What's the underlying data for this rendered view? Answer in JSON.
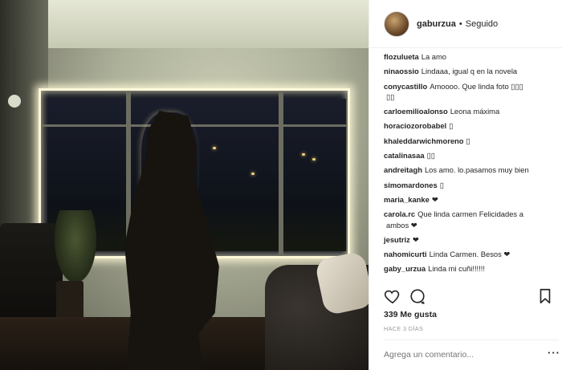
{
  "post": {
    "username": "gaburzua",
    "separator": "•",
    "follow_status": "Seguido",
    "likes": "339 Me gusta",
    "time_ago": "HACE 3 DÍAS",
    "comment_placeholder": "Agrega un comentario...",
    "more_label": "···"
  },
  "comments": [
    {
      "author": "flozulueta",
      "text": "La amo"
    },
    {
      "author": "ninaossio",
      "text": "Lindaaa, igual q en la novela"
    },
    {
      "author": "conycastillo",
      "text": "Amoooo. Que linda foto ▯▯▯"
    },
    {
      "author": "",
      "text": "▯▯"
    },
    {
      "author": "carloemilioalonso",
      "text": "Leona máxima"
    },
    {
      "author": "horaciozorobabel",
      "text": "▯"
    },
    {
      "author": "khaleddarwichmoreno",
      "text": "▯"
    },
    {
      "author": "catalinasaa",
      "text": "▯▯"
    },
    {
      "author": "andreitagh",
      "text": "Los amo. lo.pasamos muy bien"
    },
    {
      "author": "simomardones",
      "text": "▯"
    },
    {
      "author": "maria_kanke",
      "text": "❤"
    },
    {
      "author": "carola.rc",
      "text": "Que linda carmen Felicidades a"
    },
    {
      "author": "",
      "text": "ambos ❤"
    },
    {
      "author": "jesutriz",
      "text": "❤"
    },
    {
      "author": "nahomicurti",
      "text": "Linda Carmen. Besos ❤"
    },
    {
      "author": "gaby_urzua",
      "text": "Linda mi cuñi!!!!!!"
    }
  ],
  "icons": {
    "like": "heart-icon",
    "comment": "comment-bubble-icon",
    "save": "bookmark-icon"
  },
  "colors": {
    "text": "#262626",
    "muted": "#999999",
    "border": "#efefef"
  }
}
